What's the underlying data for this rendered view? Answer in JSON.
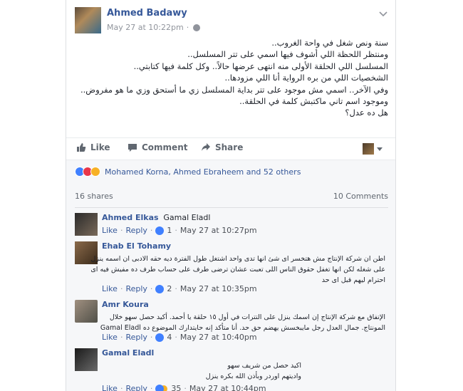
{
  "post": {
    "author": "Ahmed Badawy",
    "timestamp": "May 27 at 10:22pm",
    "separator": "·",
    "lines": [
      "سنة ونص شغل في واحة الغروب..",
      "ومنتظر اللحظة اللي أشوف فيها اسمي على تتر المسلسل..",
      "المسلسل اللي الحلقة الأولى منه انتهى عرضها حالاً.. وكل كلمة فيها كتابتي..",
      "الشخصيات اللي من بره الرواية أنا اللي مزودها..",
      "وفي الآخر.. اسمي مش موجود على تتر بداية المسلسل زي ما أستحق وزي ما هو مفروض..",
      "وموجود اسم تاني ماكتبش كلمة في الحلقة..",
      "هل ده عدل؟"
    ]
  },
  "actions": {
    "like": "Like",
    "comment": "Comment",
    "share": "Share"
  },
  "reactions": {
    "text": "Mohamed Korna, Ahmed Ebraheem and 52 others"
  },
  "stats": {
    "shares": "16 shares",
    "comments": "10 Comments"
  },
  "comments": [
    {
      "name": "Ahmed Elkas",
      "tag": "Gamal Eladl",
      "lines": [],
      "like": "Like",
      "reply": "Reply",
      "count": "1",
      "time": "May 27 at 10:27pm"
    },
    {
      "name": "Ehab El Tohamy",
      "tag": "",
      "lines": [
        "اطن ان شركة الإنتاج مش هتخسر اى شئ انها تدى واحد اشتغل طول الفترة ديه حقه الادبى ان اسمه ينزل",
        "على شغله لكن انها تغفل حقوق الناس اللى تعبت عشان ترضى طرف على حساب طرف ده مفيش فيه اى",
        "احترام ليهم قبل اى حد"
      ],
      "like": "Like",
      "reply": "Reply",
      "count": "2",
      "time": "May 27 at 10:35pm"
    },
    {
      "name": "Amr Koura",
      "tag": "",
      "lines": [
        "الإتفاق مع شركة الإنتاج إن اسمك ينزل على التترات في أول ١٥ حلقة يا أحمد. أكيد حصل سهو خلال",
        "المونتاج. جمال العدل رجل مايبخسش يهضم حق حد. أنا متأكد إنه حايتدارك الموضوع ده Gamal Eladl"
      ],
      "like": "Like",
      "reply": "Reply",
      "count": "4",
      "time": "May 27 at 10:40pm"
    },
    {
      "name": "Gamal Eladl",
      "tag": "",
      "lines": [
        "اكيد حصل من شريف سهو",
        "واديتهم اوردر وبأذن الله بكره ينزل"
      ],
      "like": "Like",
      "reply": "Reply",
      "count": "35",
      "time": "May 27 at 10:44pm"
    }
  ],
  "icons": {
    "author_avatar": "author-avatar",
    "globe": "globe-icon",
    "menu": "chevron-down-icon"
  },
  "colors": {
    "name_blue": "#365899",
    "like_blue": "#4080ff",
    "meta_gray": "#90949c",
    "comments_bg": "#f6f7f9"
  }
}
